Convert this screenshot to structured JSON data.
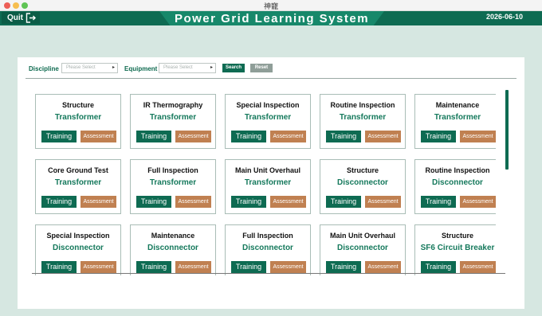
{
  "window": {
    "title": "神寵"
  },
  "header": {
    "quit_label": "Quit",
    "title": "Power Grid Learning System",
    "date": "2026-06-10"
  },
  "filters": {
    "discipline_label": "Discipline",
    "discipline_placeholder": "Please Select",
    "equipment_label": "Equipment",
    "equipment_placeholder": "Please Select",
    "search_label": "Search",
    "reset_label": "Reset"
  },
  "cards": [
    {
      "title": "Structure",
      "equipment": "Transformer",
      "train": "Training",
      "assess": "Assessment"
    },
    {
      "title": "IR Thermography",
      "equipment": "Transformer",
      "train": "Training",
      "assess": "Assessment"
    },
    {
      "title": "Special Inspection",
      "equipment": "Transformer",
      "train": "Training",
      "assess": "Assessment"
    },
    {
      "title": "Routine Inspection",
      "equipment": "Transformer",
      "train": "Training",
      "assess": "Assessment"
    },
    {
      "title": "Maintenance",
      "equipment": "Transformer",
      "train": "Training",
      "assess": "Assessment"
    },
    {
      "title": "Core Ground Test",
      "equipment": "Transformer",
      "train": "Training",
      "assess": "Assessment"
    },
    {
      "title": "Full Inspection",
      "equipment": "Transformer",
      "train": "Training",
      "assess": "Assessment"
    },
    {
      "title": "Main Unit Overhaul",
      "equipment": "Transformer",
      "train": "Training",
      "assess": "Assessment"
    },
    {
      "title": "Structure",
      "equipment": "Disconnector",
      "train": "Training",
      "assess": "Assessment"
    },
    {
      "title": "Routine Inspection",
      "equipment": "Disconnector",
      "train": "Training",
      "assess": "Assessment"
    },
    {
      "title": "Special Inspection",
      "equipment": "Disconnector",
      "train": "Training",
      "assess": "Assessment"
    },
    {
      "title": "Maintenance",
      "equipment": "Disconnector",
      "train": "Training",
      "assess": "Assessment"
    },
    {
      "title": "Full Inspection",
      "equipment": "Disconnector",
      "train": "Training",
      "assess": "Assessment"
    },
    {
      "title": "Main Unit Overhaul",
      "equipment": "Disconnector",
      "train": "Training",
      "assess": "Assessment"
    },
    {
      "title": "Structure",
      "equipment": "SF6 Circuit Breaker",
      "train": "Training",
      "assess": "Assessment"
    }
  ],
  "icons": {
    "quit": "exit-icon"
  },
  "colors": {
    "primary": "#0e6b52",
    "accent": "#c08051",
    "reset": "#8f9e98"
  }
}
